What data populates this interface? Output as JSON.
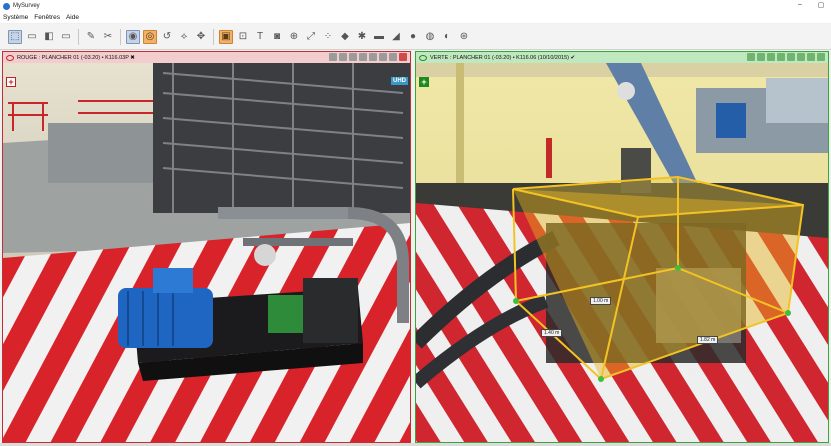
{
  "window": {
    "title": "MySurvey",
    "controls": [
      "–",
      "▢"
    ]
  },
  "menu": [
    "Système",
    "Fenêtres",
    "Aide"
  ],
  "toolbar": {
    "groups": [
      [
        {
          "name": "select-tool-icon",
          "glyph": "⬚",
          "state": "pressed"
        },
        {
          "name": "save-icon",
          "glyph": "▭",
          "state": ""
        },
        {
          "name": "view-icon",
          "glyph": "◧",
          "state": ""
        },
        {
          "name": "screen-icon",
          "glyph": "▭",
          "state": ""
        }
      ],
      [
        {
          "name": "pen-icon",
          "glyph": "✎",
          "state": ""
        },
        {
          "name": "scissors-icon",
          "glyph": "✂",
          "state": ""
        }
      ],
      [
        {
          "name": "eye-icon",
          "glyph": "◉",
          "state": "pressed"
        },
        {
          "name": "camera-eye-icon",
          "glyph": "◎",
          "state": "active"
        },
        {
          "name": "rotate-icon",
          "glyph": "↺",
          "state": ""
        },
        {
          "name": "axes-icon",
          "glyph": "⟡",
          "state": ""
        },
        {
          "name": "move-icon",
          "glyph": "✥",
          "state": ""
        }
      ],
      [
        {
          "name": "box-tool-icon",
          "glyph": "▣",
          "state": "active"
        },
        {
          "name": "cube-icon",
          "glyph": "⊡",
          "state": ""
        },
        {
          "name": "text-icon",
          "glyph": "T",
          "state": ""
        },
        {
          "name": "photo-icon",
          "glyph": "◙",
          "state": ""
        },
        {
          "name": "target-icon",
          "glyph": "⊕",
          "state": ""
        },
        {
          "name": "measure-icon",
          "glyph": "⤢",
          "state": ""
        },
        {
          "name": "points-icon",
          "glyph": "⁘",
          "state": ""
        },
        {
          "name": "plane-icon",
          "glyph": "◆",
          "state": ""
        },
        {
          "name": "shape-icon",
          "glyph": "✱",
          "state": ""
        },
        {
          "name": "pipe-icon",
          "glyph": "▬",
          "state": ""
        },
        {
          "name": "beam-icon",
          "glyph": "◢",
          "state": ""
        },
        {
          "name": "sphere-icon",
          "glyph": "●",
          "state": ""
        },
        {
          "name": "flange-icon",
          "glyph": "◍",
          "state": ""
        },
        {
          "name": "valve-icon",
          "glyph": "◐",
          "state": ""
        },
        {
          "name": "compass-icon",
          "glyph": "⊛",
          "state": ""
        }
      ]
    ]
  },
  "viewers": {
    "left": {
      "title": "ROUGE : PLANCHER 01 (-03.20) • K116.03P ✖",
      "badge": "UHD",
      "plus": "+"
    },
    "right": {
      "title": "VERTE : PLANCHER 01 (-03.20) • K116.06 (10/10/2015) ✔",
      "plus": "+",
      "dimensions": [
        "1.00 m",
        "1.40 m",
        "1.82 m"
      ]
    }
  },
  "colors": {
    "left_accent": "#c03030",
    "right_accent": "#36a636",
    "box_fill": "#e7b41a",
    "active_tool": "#f2b06b"
  }
}
